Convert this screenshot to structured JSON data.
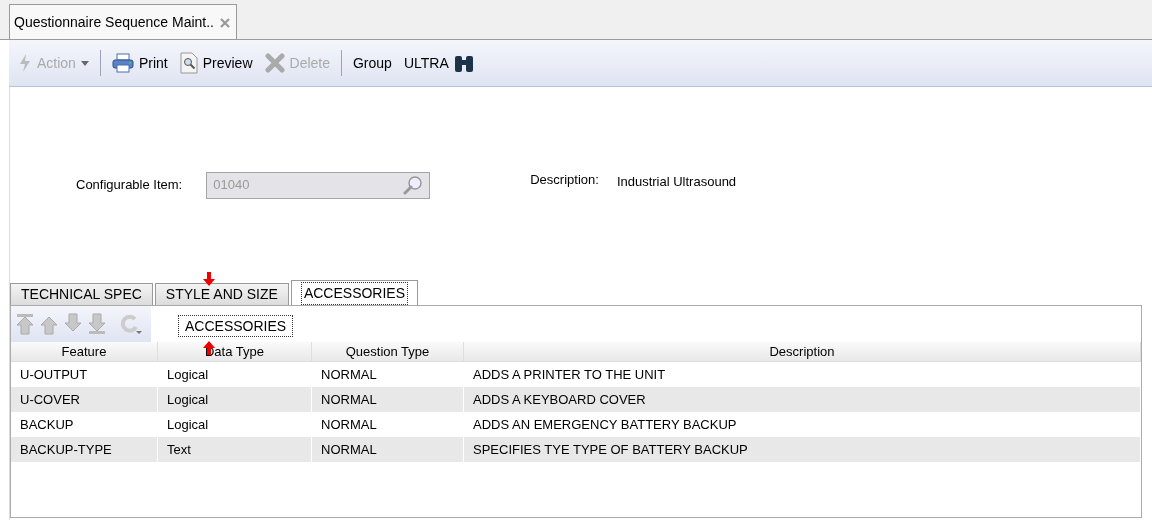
{
  "document_tab": {
    "title": "Questionnaire Sequence Maint..",
    "selected": true
  },
  "toolbar": [
    {
      "kind": "dropdown",
      "label": "Action",
      "disabled": true
    },
    {
      "kind": "separator"
    },
    {
      "kind": "button",
      "label": "Print",
      "disabled": false
    },
    {
      "kind": "button",
      "label": "Preview",
      "disabled": false
    },
    {
      "kind": "button",
      "label": "Delete",
      "disabled": true
    },
    {
      "kind": "separator"
    },
    {
      "kind": "button",
      "label": "Group",
      "disabled": false
    },
    {
      "kind": "button",
      "label": "ULTRA",
      "disabled": false
    }
  ],
  "form": {
    "configurable_item": {
      "label": "Configurable Item:",
      "value": "01040",
      "disabled": true
    },
    "description": {
      "label": "Description:",
      "value": "Industrial Ultrasound"
    }
  },
  "tabs": [
    {
      "label": "TECHNICAL SPEC",
      "selected": false
    },
    {
      "label": "STYLE AND SIZE",
      "selected": false
    },
    {
      "label": "ACCESSORIES",
      "selected": true
    }
  ],
  "drag_ghost": {
    "label": "ACCESSORIES"
  },
  "table": {
    "columns": [
      "Feature",
      "Data Type",
      "Question Type",
      "Description"
    ],
    "rows": [
      [
        "U-OUTPUT",
        "Logical",
        "NORMAL",
        "ADDS A PRINTER TO THE UNIT"
      ],
      [
        "U-COVER",
        "Logical",
        "NORMAL",
        "ADDS A KEYBOARD COVER"
      ],
      [
        "BACKUP",
        "Logical",
        "NORMAL",
        "ADDS AN EMERGENCY BATTERY BACKUP"
      ],
      [
        "BACKUP-TYPE",
        "Text",
        "NORMAL",
        "SPECIFIES TYE TYPE OF BATTERY BACKUP"
      ]
    ]
  }
}
